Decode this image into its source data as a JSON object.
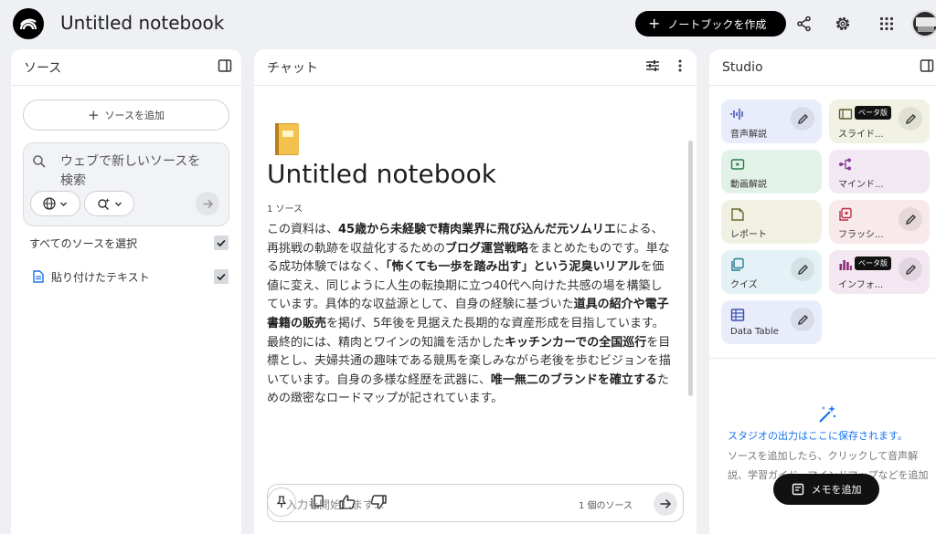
{
  "header": {
    "notebook_title": "Untitled notebook",
    "create_label": "ノートブックを作成"
  },
  "sources": {
    "title": "ソース",
    "add_label": "ソースを追加",
    "search_placeholder": "ウェブで新しいソースを検索",
    "select_all_label": "すべてのソースを選択",
    "items": [
      {
        "label": "貼り付けたテキスト",
        "checked": true
      }
    ]
  },
  "chat": {
    "title": "チャット",
    "notebook_title": "Untitled notebook",
    "source_count": "1 ソース",
    "summary": [
      {
        "t": "この資料は、"
      },
      {
        "t": "45歳から未経験で精肉業界に飛び込んだ元ソムリエ",
        "b": true
      },
      {
        "t": "による、再挑戦の軌跡を収益化するための"
      },
      {
        "t": "ブログ運営戦略",
        "b": true
      },
      {
        "t": "をまとめたものです。単なる成功体験ではなく、"
      },
      {
        "t": "「怖くても一歩を踏み出す」という泥臭いリアル",
        "b": true
      },
      {
        "t": "を価値に変え、同じように人生の転換期に立つ40代へ向けた共感の場を構築しています。具体的な収益源として、自身の経験に基づいた"
      },
      {
        "t": "道具の紹介や電子書籍の販売",
        "b": true
      },
      {
        "t": "を掲げ、5年後を見据えた長期的な資産形成を目指しています。最終的には、精肉とワインの知識を活かした"
      },
      {
        "t": "キッチンカーでの全国巡行",
        "b": true
      },
      {
        "t": "を目標とし、夫婦共通の趣味である競馬を楽しみながら老後を歩むビジョンを描いています。自身の多様な経歴を武器に、"
      },
      {
        "t": "唯一無二のブランドを確立する",
        "b": true
      },
      {
        "t": "ための緻密なロードマップが記されています。"
      }
    ],
    "input_placeholder": "入力を開始します...",
    "input_source_count": "1 個のソース"
  },
  "studio": {
    "title": "Studio",
    "tiles": [
      {
        "label": "音声解説",
        "bg": "#e9ecfa",
        "accent": "#3b4fb8",
        "icon": "audio-icon",
        "edit": true
      },
      {
        "label": "スライド...",
        "bg": "#f1f2e4",
        "accent": "#5c5a2e",
        "icon": "slides-icon",
        "edit": true,
        "beta": "ベータ版"
      },
      {
        "label": "動画解説",
        "bg": "#e3f2e8",
        "accent": "#2b7a47",
        "icon": "video-icon",
        "edit": false
      },
      {
        "label": "マインド...",
        "bg": "#f1e8f4",
        "accent": "#8a3d9a",
        "icon": "mindmap-icon",
        "edit": false
      },
      {
        "label": "レポート",
        "bg": "#f1f1e3",
        "accent": "#6a6a2a",
        "icon": "report-icon",
        "edit": false
      },
      {
        "label": "フラッシ...",
        "bg": "#f8e9ea",
        "accent": "#b8324a",
        "icon": "flashcard-icon",
        "edit": true
      },
      {
        "label": "クイズ",
        "bg": "#e4f1f6",
        "accent": "#2a7a92",
        "icon": "quiz-icon",
        "edit": true
      },
      {
        "label": "インフォ...",
        "bg": "#f3e7f1",
        "accent": "#8a2d7a",
        "icon": "infographic-icon",
        "edit": true,
        "beta": "ベータ版"
      },
      {
        "label": "Data Table",
        "bg": "#e9ecfa",
        "accent": "#3b4fb8",
        "icon": "table-icon",
        "edit": true
      }
    ],
    "saved_title": "スタジオの出力はここに保存されます。",
    "saved_desc": "ソースを追加したら、クリックして音声解説、学習ガイド、マインドマップなどを追加できます。",
    "memo_label": "メモを追加"
  }
}
